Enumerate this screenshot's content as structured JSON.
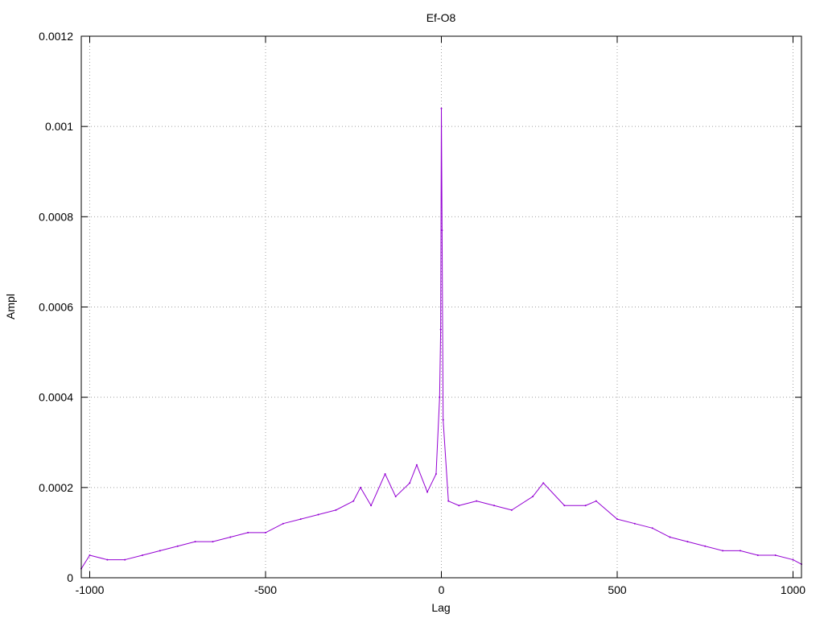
{
  "chart_data": {
    "type": "line",
    "title": "Ef-O8",
    "xlabel": "Lag",
    "ylabel": "Ampl",
    "xlim": [
      -1024,
      1024
    ],
    "ylim": [
      0,
      0.0012
    ],
    "grid": true,
    "xticks": [
      {
        "value": -1000,
        "label": "-1000"
      },
      {
        "value": -500,
        "label": "-500"
      },
      {
        "value": 0,
        "label": "0"
      },
      {
        "value": 500,
        "label": "500"
      },
      {
        "value": 1000,
        "label": "1000"
      }
    ],
    "yticks": [
      {
        "value": 0,
        "label": "0"
      },
      {
        "value": 0.0002,
        "label": "0.0002"
      },
      {
        "value": 0.0004,
        "label": "0.0004"
      },
      {
        "value": 0.0006,
        "label": "0.0006"
      },
      {
        "value": 0.0008,
        "label": "0.0008"
      },
      {
        "value": 0.001,
        "label": "0.001"
      },
      {
        "value": 0.0012,
        "label": "0.0012"
      }
    ],
    "series": [
      {
        "color": "#9400d3",
        "points": [
          [
            -1024,
            2e-05
          ],
          [
            -1000,
            5e-05
          ],
          [
            -950,
            4e-05
          ],
          [
            -900,
            4e-05
          ],
          [
            -850,
            5e-05
          ],
          [
            -800,
            6e-05
          ],
          [
            -750,
            7e-05
          ],
          [
            -700,
            8e-05
          ],
          [
            -650,
            8e-05
          ],
          [
            -600,
            9e-05
          ],
          [
            -550,
            0.0001
          ],
          [
            -500,
            0.0001
          ],
          [
            -450,
            0.00012
          ],
          [
            -400,
            0.00013
          ],
          [
            -350,
            0.00014
          ],
          [
            -300,
            0.00015
          ],
          [
            -250,
            0.00017
          ],
          [
            -230,
            0.0002
          ],
          [
            -200,
            0.00016
          ],
          [
            -160,
            0.00023
          ],
          [
            -130,
            0.00018
          ],
          [
            -90,
            0.00021
          ],
          [
            -70,
            0.00025
          ],
          [
            -40,
            0.00019
          ],
          [
            -15,
            0.00023
          ],
          [
            -5,
            0.0004
          ],
          [
            -2,
            0.00055
          ],
          [
            0,
            0.00104
          ],
          [
            2,
            0.00077
          ],
          [
            5,
            0.00035
          ],
          [
            20,
            0.00017
          ],
          [
            50,
            0.00016
          ],
          [
            100,
            0.00017
          ],
          [
            150,
            0.00016
          ],
          [
            200,
            0.00015
          ],
          [
            260,
            0.00018
          ],
          [
            290,
            0.00021
          ],
          [
            350,
            0.00016
          ],
          [
            410,
            0.00016
          ],
          [
            440,
            0.00017
          ],
          [
            500,
            0.00013
          ],
          [
            550,
            0.00012
          ],
          [
            600,
            0.00011
          ],
          [
            650,
            9e-05
          ],
          [
            700,
            8e-05
          ],
          [
            750,
            7e-05
          ],
          [
            800,
            6e-05
          ],
          [
            850,
            6e-05
          ],
          [
            900,
            5e-05
          ],
          [
            950,
            5e-05
          ],
          [
            1000,
            4e-05
          ],
          [
            1024,
            3e-05
          ]
        ]
      }
    ]
  }
}
